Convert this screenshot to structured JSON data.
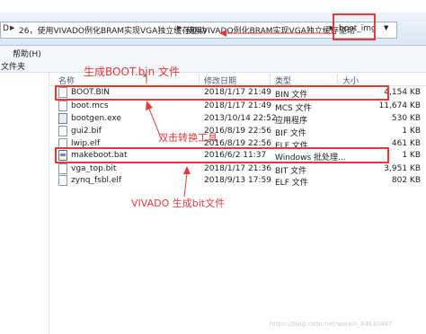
{
  "address": {
    "prefix": "D",
    "crumbs": [
      "26，使用VIVADO例化BRAM实现VGA独立缓存驱动",
      "使用VIVADO例化BRAM实现VGA独立缓存驱动",
      "boot_img"
    ]
  },
  "menu": {
    "help": "帮助(H)"
  },
  "nav": {
    "folder": "文件夹"
  },
  "columns": {
    "name": "名称",
    "date": "修改日期",
    "type": "类型",
    "size": "大小"
  },
  "files": [
    {
      "name": "BOOT.BIN",
      "date": "2018/1/17 21:49",
      "type": "BIN 文件",
      "size": "4,154 KB"
    },
    {
      "name": "boot.mcs",
      "date": "2018/1/17 21:49",
      "type": "MCS 文件",
      "size": "11,674 KB"
    },
    {
      "name": "bootgen.exe",
      "date": "2013/10/14 22:52",
      "type": "应用程序",
      "size": "530 KB"
    },
    {
      "name": "gui2.bif",
      "date": "2016/8/19 22:56",
      "type": "BIF 文件",
      "size": "1 KB"
    },
    {
      "name": "lwip.elf",
      "date": "2016/8/19 22:56",
      "type": "ELF 文件",
      "size": "461 KB"
    },
    {
      "name": "makeboot.bat",
      "date": "2016/6/2 11:37",
      "type": "Windows 批处理...",
      "size": "1 KB"
    },
    {
      "name": "vga_top.bit",
      "date": "2018/1/17 21:36",
      "type": "BIT 文件",
      "size": "3,951 KB"
    },
    {
      "name": "zynq_fsbl.elf",
      "date": "2018/9/13 17:59",
      "type": "ELF 文件",
      "size": "802 KB"
    }
  ],
  "annotations": {
    "boot_bin": "生成BOOT.bin 文件",
    "tool": "双击转换工具",
    "bit": "VIVADO 生成bit文件"
  },
  "watermark": "https://blog.csdn.net/weixin_44830487",
  "colors": {
    "highlight": "#e63a3a",
    "annotation_text": "#e23b3b"
  }
}
